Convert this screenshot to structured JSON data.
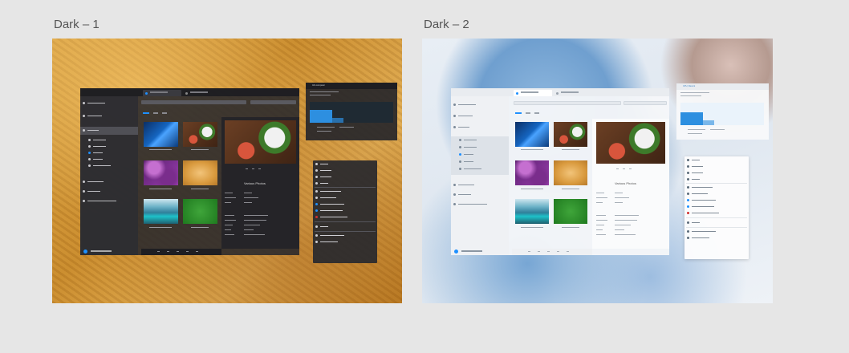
{
  "frames": [
    {
      "id": "dark-1",
      "label": "Dark – 1",
      "theme": "acrylic dark over sand wallpaper"
    },
    {
      "id": "dark-2",
      "label": "Dark – 2",
      "theme": "light acrylic over winter wallpaper"
    }
  ],
  "mockup": {
    "detail_title_dark": "Various Photos",
    "detail_title_light": "Various Photos",
    "task_manager_subtitle": "CPU, Recent",
    "task_manager_heading": "Info computer"
  },
  "colors": {
    "page_background": "#e6e6e6",
    "accent": "#1e90ff",
    "label_text": "#555555"
  }
}
